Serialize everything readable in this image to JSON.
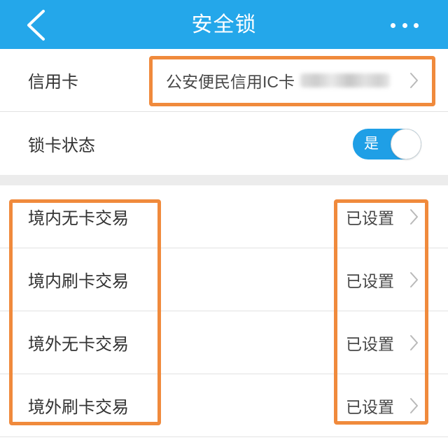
{
  "header": {
    "title": "安全锁",
    "back_icon": "chevron-left-icon",
    "more_icon": "more-dots-icon"
  },
  "card_section": {
    "credit_card": {
      "label": "信用卡",
      "value": "公安便民信用IC卡",
      "chevron_icon": "chevron-right-icon"
    },
    "lock_status": {
      "label": "锁卡状态",
      "toggle_label": "是",
      "on": true
    }
  },
  "transactions": [
    {
      "label": "境内无卡交易",
      "value": "已设置",
      "chevron_icon": "chevron-right-icon"
    },
    {
      "label": "境内刷卡交易",
      "value": "已设置",
      "chevron_icon": "chevron-right-icon"
    },
    {
      "label": "境外无卡交易",
      "value": "已设置",
      "chevron_icon": "chevron-right-icon"
    },
    {
      "label": "境外刷卡交易",
      "value": "已设置",
      "chevron_icon": "chevron-right-icon"
    }
  ],
  "colors": {
    "header_bg": "#24a7ea",
    "toggle_on": "#1f9fe6",
    "annotation": "#f08a3c",
    "section_gap": "#ececec",
    "label_text": "#333333",
    "value_text": "#474747",
    "chevron": "#b9b9b9"
  }
}
